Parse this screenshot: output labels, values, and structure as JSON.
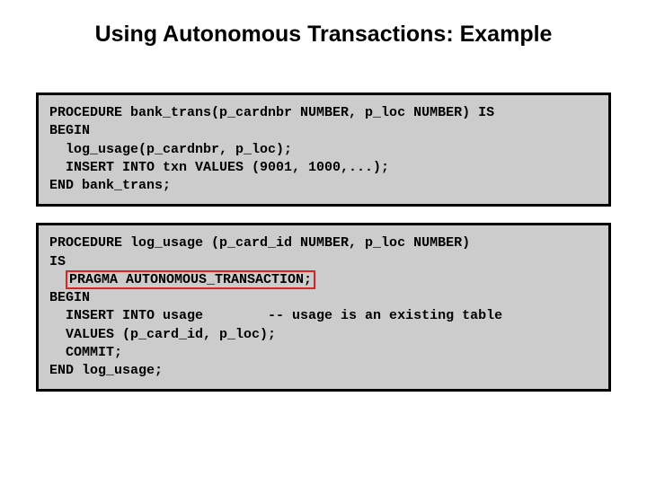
{
  "title": "Using Autonomous Transactions: Example",
  "code1": {
    "l1": "PROCEDURE bank_trans(p_cardnbr NUMBER, p_loc NUMBER) IS",
    "l2": "BEGIN",
    "l3": "  log_usage(p_cardnbr, p_loc); ",
    "l4": "  INSERT INTO txn VALUES (9001, 1000,...);",
    "l5": "END bank_trans;"
  },
  "code2": {
    "l1": "PROCEDURE log_usage (p_card_id NUMBER, p_loc NUMBER)",
    "l2": "IS",
    "l3_indent": "  ",
    "l3_hl": "PRAGMA AUTONOMOUS_TRANSACTION;",
    "l4": "BEGIN",
    "l5": "  INSERT INTO usage        -- usage is an existing table",
    "l6": "  VALUES (p_card_id, p_loc);",
    "l7": "  COMMIT; ",
    "l8": "END log_usage;"
  }
}
